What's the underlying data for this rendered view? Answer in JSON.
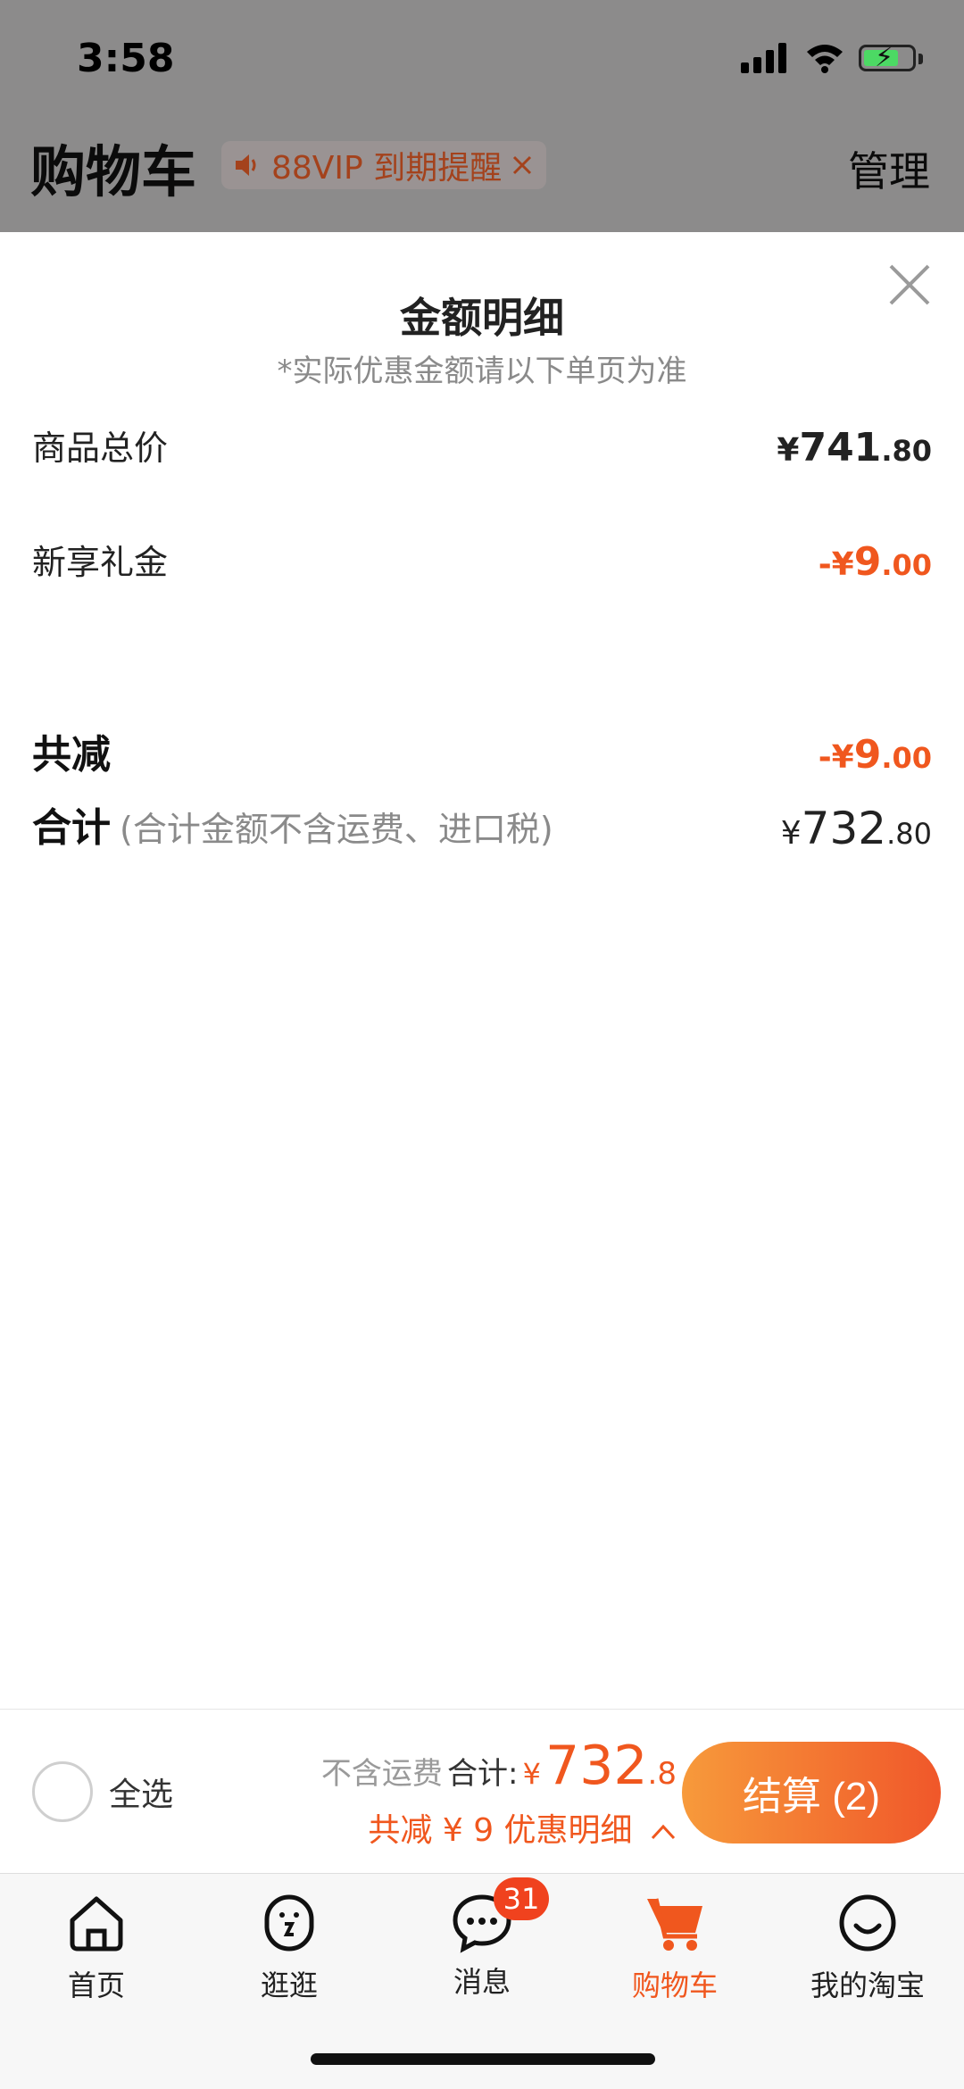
{
  "status_bar": {
    "time": "3:58"
  },
  "header": {
    "title": "购物车",
    "vip_notice": "88VIP 到期提醒",
    "manage": "管理"
  },
  "detail_sheet": {
    "title": "金额明细",
    "subtitle": "*实际优惠金额请以下单页为准",
    "rows": [
      {
        "label": "商品总价",
        "value_prefix": "¥",
        "value_int": "741",
        "value_dec": ".80"
      },
      {
        "label": "新享礼金",
        "value_prefix": "-¥",
        "value_int": "9",
        "value_dec": ".00"
      }
    ],
    "total_discount": {
      "label": "共减",
      "value_prefix": "-¥",
      "value_int": "9",
      "value_dec": ".00"
    },
    "total": {
      "label": "合计",
      "hint": "(合计金额不含运费、进口税)",
      "value_prefix": "¥",
      "value_int": "732",
      "value_dec": ".80"
    }
  },
  "summary_bar": {
    "select_all": "全选",
    "shipping_note": "不含运费",
    "total_label": "合计:",
    "currency": "¥",
    "total_int": "732",
    "total_dec": ".8",
    "discount_line": "共减 ¥ 9  优惠明细",
    "checkout": "结算 (2)"
  },
  "tab_bar": {
    "tabs": [
      {
        "label": "首页",
        "icon": "home-icon"
      },
      {
        "label": "逛逛",
        "icon": "explore-icon"
      },
      {
        "label": "消息",
        "icon": "message-icon",
        "badge": "31"
      },
      {
        "label": "购物车",
        "icon": "cart-icon",
        "active": true
      },
      {
        "label": "我的淘宝",
        "icon": "profile-icon"
      }
    ]
  },
  "colors": {
    "accent": "#f0571e",
    "checkout_start": "#f79a3b",
    "checkout_end": "#f0572a"
  }
}
